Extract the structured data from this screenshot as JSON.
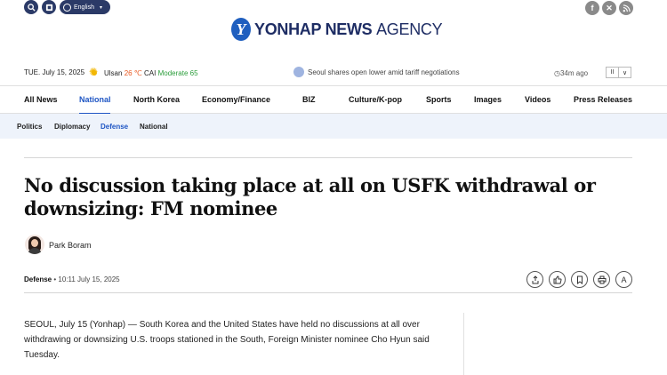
{
  "topbar": {
    "language": "English",
    "social": [
      "facebook-icon",
      "x-icon",
      "rss-icon"
    ]
  },
  "logo": {
    "mark": "Y",
    "bold": "YONHAP NEWS",
    "light": "AGENCY"
  },
  "infobar": {
    "date": "TUE. July 15, 2025",
    "city": "Ulsan",
    "temperature": "26 ℃",
    "cai_label": "CAI",
    "cai_value": "Moderate 65",
    "ticker": "Seoul shares open lower amid tariff negotiations",
    "time_ago": "34m ago",
    "pause": "II",
    "expand": "∨"
  },
  "nav": {
    "items": [
      "All News",
      "National",
      "North Korea",
      "Economy/Finance",
      "BIZ",
      "Culture/K-pop",
      "Sports",
      "Images",
      "Videos",
      "Press Releases"
    ],
    "active": "National"
  },
  "subnav": {
    "items": [
      "Politics",
      "Diplomacy",
      "Defense",
      "National"
    ],
    "active": "Defense"
  },
  "article": {
    "headline": "No discussion taking place at all on USFK withdrawal or downsizing: FM nominee",
    "author": "Park Boram",
    "category": "Defense",
    "timestamp": " • 10:11 July 15, 2025",
    "body": "SEOUL, July 15 (Yonhap) — South Korea and the United States have held no discussions at all over withdrawing or downsizing U.S. troops stationed in the South, Foreign Minister nominee Cho Hyun said Tuesday.",
    "font_size_label": "A"
  },
  "colors": {
    "brand_navy": "#1e2d64",
    "accent_blue": "#1f56c4",
    "subnav_bg": "#eef3fb"
  }
}
